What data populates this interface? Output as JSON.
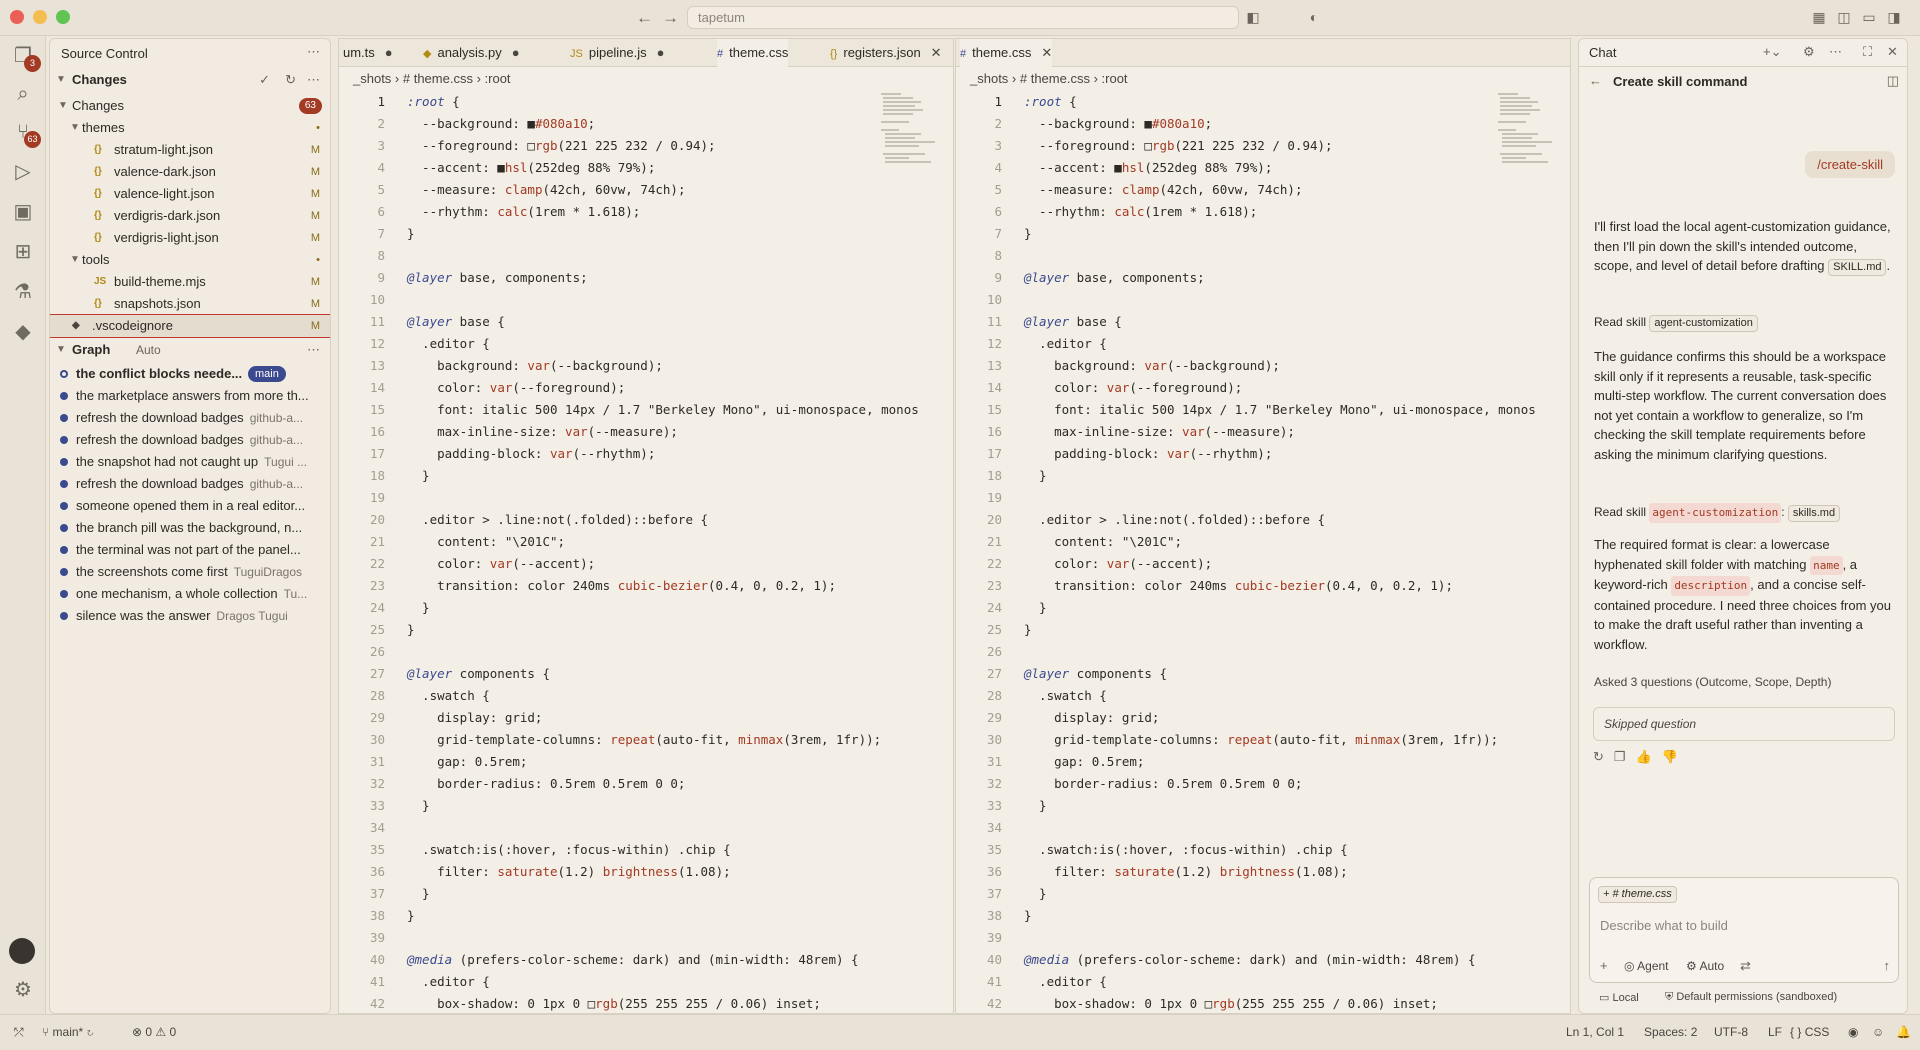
{
  "window": {
    "search_text": "tapetum"
  },
  "activity": {
    "explorer_badge": "3",
    "scm_badge": "63"
  },
  "scm": {
    "header": "Source Control",
    "changes_section": "Changes",
    "changes_group": "Changes",
    "changes_count": "63",
    "tree": [
      {
        "label": "themes",
        "kind": "folder",
        "status": "•"
      },
      {
        "label": "stratum-light.json",
        "kind": "json",
        "status": "M"
      },
      {
        "label": "valence-dark.json",
        "kind": "json",
        "status": "M"
      },
      {
        "label": "valence-light.json",
        "kind": "json",
        "status": "M"
      },
      {
        "label": "verdigris-dark.json",
        "kind": "json",
        "status": "M"
      },
      {
        "label": "verdigris-light.json",
        "kind": "json",
        "status": "M"
      },
      {
        "label": "tools",
        "kind": "folder",
        "status": "•"
      },
      {
        "label": "build-theme.mjs",
        "kind": "js",
        "status": "M"
      },
      {
        "label": "snapshots.json",
        "kind": "json",
        "status": "M"
      },
      {
        "label": ".vscodeignore",
        "kind": "ignore",
        "status": "M"
      }
    ],
    "graph_label": "Graph",
    "graph_auto": "Auto",
    "branch_pill": "main",
    "commits": [
      {
        "msg": "the conflict blocks neede...",
        "author": ""
      },
      {
        "msg": "the marketplace answers from more th...",
        "author": ""
      },
      {
        "msg": "refresh the download badges",
        "author": "github-a..."
      },
      {
        "msg": "refresh the download badges",
        "author": "github-a..."
      },
      {
        "msg": "the snapshot had not caught up",
        "author": "Tugui ..."
      },
      {
        "msg": "refresh the download badges",
        "author": "github-a..."
      },
      {
        "msg": "someone opened them in a real editor...",
        "author": ""
      },
      {
        "msg": "the branch pill was the background, n...",
        "author": ""
      },
      {
        "msg": "the terminal was not part of the panel...",
        "author": ""
      },
      {
        "msg": "the screenshots come first",
        "author": "TuguiDragos"
      },
      {
        "msg": "one mechanism, a whole collection",
        "author": "Tu..."
      },
      {
        "msg": "silence was the answer",
        "author": "Dragos Tugui"
      }
    ]
  },
  "editor1": {
    "tabs": [
      {
        "label": "um.ts",
        "icon": "",
        "mark": "●"
      },
      {
        "label": "analysis.py",
        "icon": "python-icon",
        "mark": "●"
      },
      {
        "label": "pipeline.js",
        "icon": "JS",
        "mark": "●"
      },
      {
        "label": "theme.css",
        "icon": "#",
        "mark": ""
      },
      {
        "label": "registers.json",
        "icon": "{}",
        "mark": "✕"
      }
    ],
    "breadcrumb": [
      "_shots",
      "# theme.css",
      ":root"
    ]
  },
  "editor2": {
    "tabs": [
      {
        "label": "theme.css",
        "icon": "#",
        "mark": "✕"
      }
    ],
    "breadcrumb": [
      "_shots",
      "# theme.css",
      ":root"
    ]
  },
  "code_lines": [
    ":root {",
    "  --background: ■#080a10;",
    "  --foreground: □rgb(221 225 232 / 0.94);",
    "  --accent: ■hsl(252deg 88% 79%);",
    "  --measure: clamp(42ch, 60vw, 74ch);",
    "  --rhythm: calc(1rem * 1.618);",
    "}",
    "",
    "@layer base, components;",
    "",
    "@layer base {",
    "  .editor {",
    "    background: var(--background);",
    "    color: var(--foreground);",
    "    font: italic 500 14px / 1.7 \"Berkeley Mono\", ui-monospace, monos",
    "    max-inline-size: var(--measure);",
    "    padding-block: var(--rhythm);",
    "  }",
    "",
    "  .editor > .line:not(.folded)::before {",
    "    content: \"\\201C\";",
    "    color: var(--accent);",
    "    transition: color 240ms cubic-bezier(0.4, 0, 0.2, 1);",
    "  }",
    "}",
    "",
    "@layer components {",
    "  .swatch {",
    "    display: grid;",
    "    grid-template-columns: repeat(auto-fit, minmax(3rem, 1fr));",
    "    gap: 0.5rem;",
    "    border-radius: 0.5rem 0.5rem 0 0;",
    "  }",
    "",
    "  .swatch:is(:hover, :focus-within) .chip {",
    "    filter: saturate(1.2) brightness(1.08);",
    "  }",
    "}",
    "",
    "@media (prefers-color-scheme: dark) and (min-width: 48rem) {",
    "  .editor {",
    "    box-shadow: 0 1px 0 □rgb(255 255 255 / 0.06) inset;"
  ],
  "chat": {
    "tab_label": "Chat",
    "title": "Create skill command",
    "user_msg": "/create-skill",
    "p1": "I'll first load the local agent-customization guidance, then I'll pin down the skill's intended outcome, scope, and level of detail before drafting",
    "p1_chip": "SKILL.md",
    "read1_label": "Read skill",
    "read1_chip": "agent-customization",
    "p2": "The guidance confirms this should be a workspace skill only if it represents a reusable, task-specific multi-step workflow. The current conversation does not yet contain a workflow to generalize, so I'm checking the skill template requirements before asking the minimum clarifying questions.",
    "read2_label": "Read skill",
    "read2_code": "agent-customization",
    "read2_chip": "skills.md",
    "p3a": "The required format is clear: a lowercase hyphenated skill folder with matching",
    "p3_code1": "name",
    "p3b": ", a keyword-rich",
    "p3_code2": "description",
    "p3c": ", and a concise self-contained procedure. I need three choices from you to make the draft useful rather than inventing a workflow.",
    "asked": "Asked 3 questions (Outcome, Scope, Depth)",
    "skipped": "Skipped question",
    "input_chip": "# theme.css",
    "input_placeholder": "Describe what to build",
    "agent_label": "Agent",
    "auto_label": "Auto",
    "local_label": "Local",
    "perm_label": "Default permissions (sandboxed)"
  },
  "status": {
    "branch": "main*",
    "errors": "0",
    "warnings": "0",
    "position": "Ln 1, Col 1",
    "spaces": "Spaces: 2",
    "encoding": "UTF-8",
    "eol": "LF",
    "lang": "CSS"
  }
}
